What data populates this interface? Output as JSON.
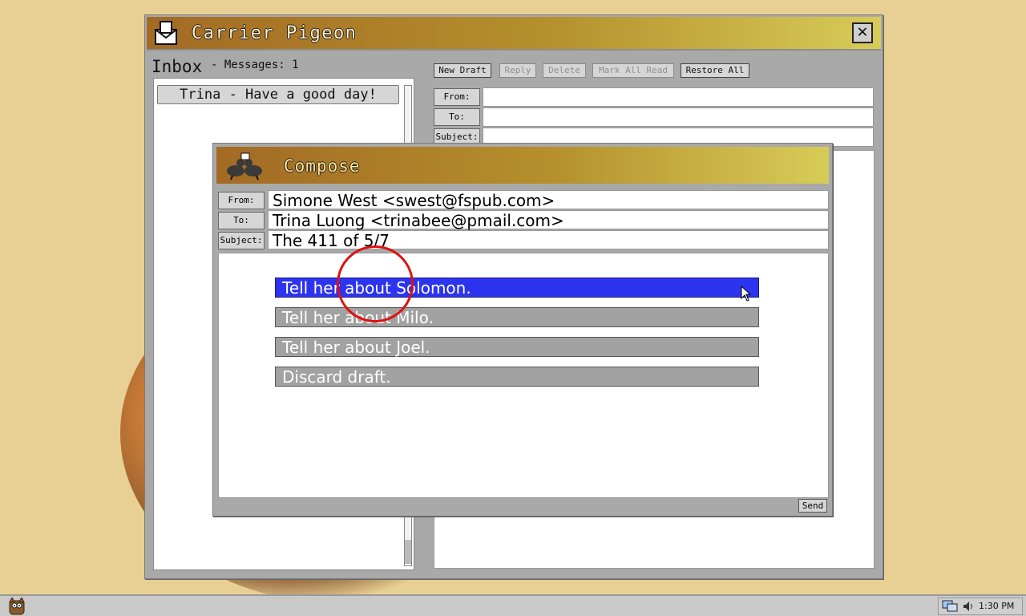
{
  "app": {
    "title": "Carrier Pigeon"
  },
  "inbox": {
    "label": "Inbox",
    "count_text": "- Messages: 1",
    "items": [
      {
        "label": "Trina - Have a good day!"
      }
    ]
  },
  "toolbar": {
    "new_draft": "New Draft",
    "reply": "Reply",
    "delete": "Delete",
    "mark_all_read": "Mark All Read",
    "restore_all": "Restore All"
  },
  "preview_headers": {
    "from_label": "From:",
    "to_label": "To:",
    "subject_label": "Subject:"
  },
  "compose": {
    "title": "Compose",
    "from_label": "From:",
    "from_value": "Simone West <swest@fspub.com>",
    "to_label": "To:",
    "to_value": "Trina Luong <trinabee@pmail.com>",
    "subject_label": "Subject:",
    "subject_value": "The 411 of 5/7",
    "choices": [
      {
        "label": "Tell her about Solomon.",
        "selected": true
      },
      {
        "label": "Tell her about Milo.",
        "selected": false
      },
      {
        "label": "Tell her about Joel.",
        "selected": false
      },
      {
        "label": "Discard draft.",
        "selected": false
      }
    ],
    "send_label": "Send"
  },
  "taskbar": {
    "clock": "1:30 PM"
  },
  "colors": {
    "title_gradient_start": "#a36a24",
    "title_gradient_end": "#d7cc58",
    "selection": "#2d34f0"
  }
}
